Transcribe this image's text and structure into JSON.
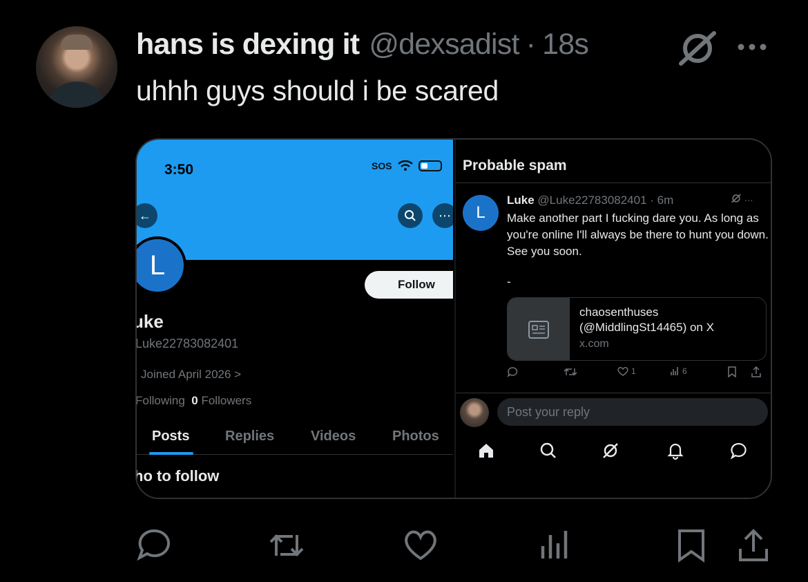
{
  "tweet": {
    "display_name": "hans is dexing it",
    "handle": "@dexsadist",
    "separator": "·",
    "time": "18s",
    "text": "uhhh guys should i be scared"
  },
  "left_screenshot": {
    "status_time": "3:50",
    "status_sos": "SOS",
    "avatar_letter": "L",
    "follow_label": "Follow",
    "name": "uke",
    "handle": "Luke22783082401",
    "joined": "Joined April 2026 >",
    "following_label": "Following",
    "followers_count": "0",
    "followers_label": "Followers",
    "tabs": [
      "Posts",
      "Replies",
      "Videos",
      "Photos"
    ],
    "who_to_follow": "ho to follow"
  },
  "right_screenshot": {
    "title": "Probable spam",
    "avatar_letter": "L",
    "author_name": "Luke",
    "author_meta": "@Luke22783082401 · 6m",
    "body": "Make another part I fucking dare you. As long as you're online I'll always be there to hunt you down. See you soon.",
    "dash": "-",
    "link_card": {
      "title": "chaosenthuses (@MiddlingSt14465) on X",
      "domain": "x.com"
    },
    "actions": {
      "likes": "1",
      "views": "6"
    },
    "reply_placeholder": "Post your reply"
  },
  "icons": {
    "grok": "grok-icon",
    "more": "more-icon",
    "reply": "reply-icon",
    "retweet": "retweet-icon",
    "like": "heart-icon",
    "views": "views-icon",
    "bookmark": "bookmark-icon",
    "share": "share-icon"
  },
  "colors": {
    "accent": "#1d9bf0",
    "background": "#000000",
    "muted": "#71767b",
    "text": "#e7e9ea"
  }
}
